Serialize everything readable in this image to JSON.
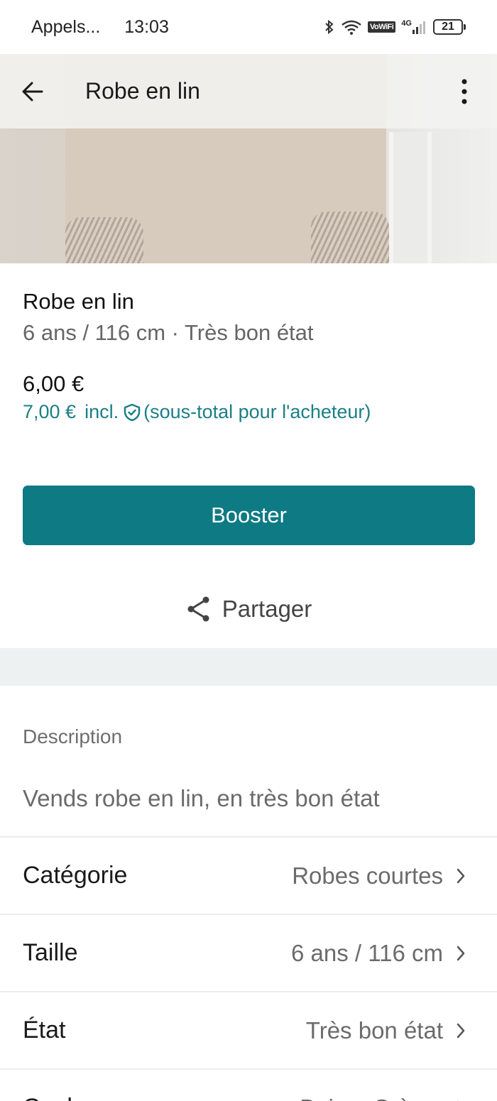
{
  "status_bar": {
    "left_text": "Appels...",
    "time": "13:03",
    "network": "4G",
    "vowifi": "VoWiFi",
    "battery": "21",
    "icons": [
      "bluetooth-icon",
      "wifi-icon",
      "vowifi-icon",
      "signal-icon",
      "battery-icon"
    ]
  },
  "app_bar": {
    "title": "Robe en lin",
    "back_icon": "arrow-left-icon",
    "more_icon": "more-vertical-icon"
  },
  "product": {
    "title": "Robe en lin",
    "subtitle": "6 ans / 116 cm · Très bon état",
    "price": "6,00 €",
    "buyer_price": "7,00 €",
    "buyer_incl": "incl.",
    "buyer_note": "(sous-total pour l'acheteur)"
  },
  "actions": {
    "booster_label": "Booster",
    "share_label": "Partager"
  },
  "description": {
    "label": "Description",
    "text": "Vends robe en lin, en très bon état"
  },
  "details": [
    {
      "label": "Catégorie",
      "value": "Robes courtes"
    },
    {
      "label": "Taille",
      "value": "6 ans / 116 cm"
    },
    {
      "label": "État",
      "value": "Très bon état"
    },
    {
      "label": "Couleur",
      "value": "Beige, Crème"
    }
  ],
  "colors": {
    "accent": "#0d7a84",
    "buyer_price": "#1b7f86",
    "divider_band": "#eef1f1"
  }
}
